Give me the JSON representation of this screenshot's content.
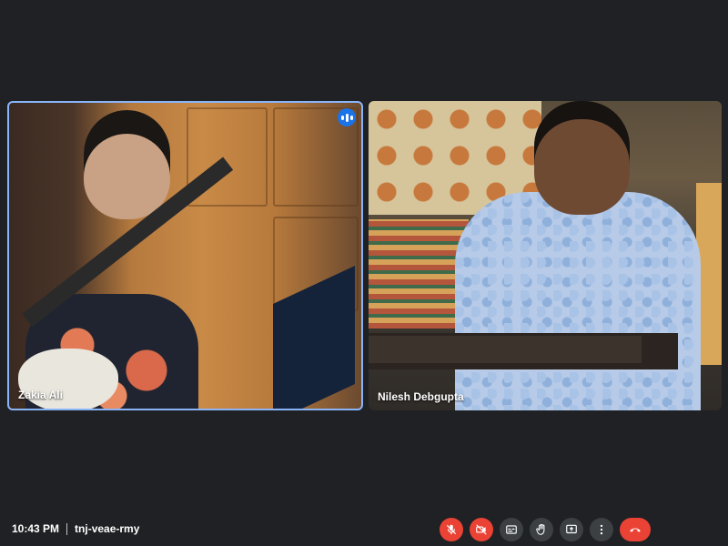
{
  "participants": [
    {
      "name": "Zakia Ali",
      "speaking": true
    },
    {
      "name": "Nilesh Debgupta",
      "speaking": false
    }
  ],
  "meeting": {
    "time": "10:43 PM",
    "code": "tnj-veae-rmy"
  },
  "controls": [
    {
      "icon": "mic-off-icon",
      "state": "off"
    },
    {
      "icon": "camera-off-icon",
      "state": "off"
    },
    {
      "icon": "captions-icon",
      "state": "normal"
    },
    {
      "icon": "raise-hand-icon",
      "state": "normal"
    },
    {
      "icon": "present-screen-icon",
      "state": "normal"
    },
    {
      "icon": "more-options-icon",
      "state": "normal"
    },
    {
      "icon": "hang-up-icon",
      "state": "danger"
    }
  ],
  "colors": {
    "background": "#202124",
    "active_speaker_border": "#8ab4f8",
    "danger": "#ea4335",
    "control_bg": "#3c4043",
    "speaking_indicator": "#1a73e8"
  }
}
